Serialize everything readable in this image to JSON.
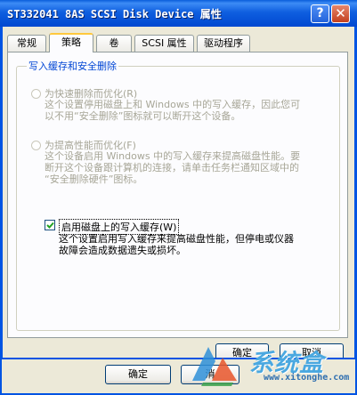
{
  "window": {
    "title": "ST332041 8AS SCSI Disk Device 属性",
    "help_label": "?",
    "close_label": "✕"
  },
  "tabs": [
    {
      "label": "常规"
    },
    {
      "label": "策略"
    },
    {
      "label": "卷"
    },
    {
      "label": "SCSI 属性"
    },
    {
      "label": "驱动程序"
    }
  ],
  "group": {
    "title": "写入缓存和安全删除"
  },
  "options": {
    "quick_removal": {
      "label": "为快速删除而优化(R)",
      "desc": [
        "这个设置停用磁盘上和 Windows 中的写入缓存，因此您可",
        "以不用“安全删除”图标就可以断开这个设备。"
      ]
    },
    "performance": {
      "label": "为提高性能而优化(F)",
      "desc": [
        "这个设备启用 Windows 中的写入缓存来提高磁盘性能。要",
        "断开这个设备跟计算机的连接，请单击任务栏通知区域中的",
        "“安全删除硬件”图标。"
      ]
    },
    "write_cache": {
      "label": "启用磁盘上的写入缓存(W)",
      "checked": true,
      "desc": [
        "这个设置启用写入缓存来提高磁盘性能，但停电或仪器",
        "故障会造成数据遗失或损坏。"
      ]
    }
  },
  "buttons": {
    "ok": "确定",
    "cancel": "取消"
  },
  "duplicate_bar": {
    "ok": "确定",
    "cancel": "消"
  },
  "watermark": {
    "text": "系统盒",
    "url": "www.xitonghe.com"
  },
  "colors": {
    "titlebar": "#0054e3",
    "group_title": "#0046d5",
    "tab_highlight": "#ffc83c",
    "watermark": "#4aa8e0"
  }
}
